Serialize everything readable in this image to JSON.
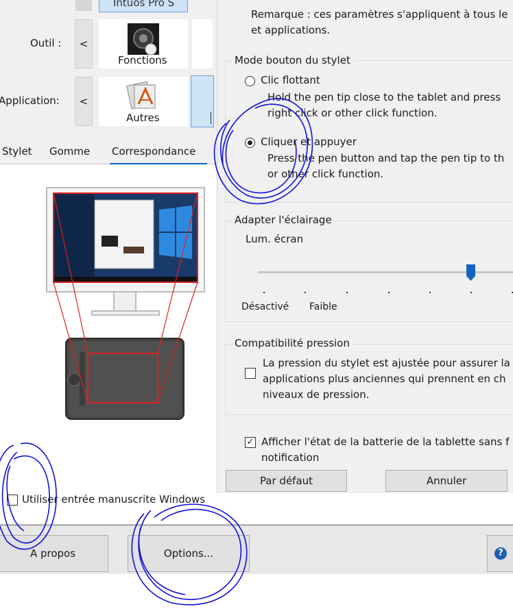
{
  "tablet_panel": {
    "device_name": "Intuos Pro S",
    "tool_label": "Outil :",
    "tool_tile_label": "Fonctions",
    "application_label": "Application:",
    "application_tile_label": "Autres",
    "tabs": [
      "Stylet",
      "Gomme",
      "Correspondance"
    ],
    "windows_ink_checkbox_label": "Utiliser entrée manuscrite Windows",
    "windows_ink_checked": false,
    "arrow_left": "<"
  },
  "options_dialog": {
    "note_line1": "Remarque : ces paramètres s'appliquent à tous le",
    "note_line2": "et applications.",
    "pen_button_mode": {
      "legend": "Mode bouton du stylet",
      "option1_label": "Clic flottant",
      "option1_desc1": "Hold the pen tip close to the tablet and press",
      "option1_desc2": "right click or other click function.",
      "option2_label": "Cliquer et appuyer",
      "option2_desc1": "Press the pen button and tap the pen tip to th",
      "option2_desc2": "or other click function.",
      "selected": "option2"
    },
    "lighting": {
      "legend": "Adapter l'éclairage",
      "screen_brightness_label": "Lum. écran",
      "label_off": "Désactivé",
      "label_low": "Faible",
      "slider_position": 0.75
    },
    "pressure_compat": {
      "legend": "Compatibilité pression",
      "line1": "La pression du stylet est ajustée pour assurer la",
      "line2": "applications plus anciennes qui prennent en ch",
      "line3": "niveaux de pression.",
      "checked": false
    },
    "battery_notification": {
      "line1": "Afficher l'état de la batterie de la tablette sans f",
      "line2": "notification",
      "checked": true,
      "check_glyph": "✓"
    },
    "buttons": {
      "defaults": "Par défaut",
      "cancel": "Annuler"
    }
  },
  "bottom_bar": {
    "about": "A propos",
    "options": "Options...",
    "help_icon_glyph": "?"
  },
  "colors": {
    "accent": "#0a64c8",
    "annotation": "#1010d8",
    "mapping_outline": "#e02020"
  }
}
